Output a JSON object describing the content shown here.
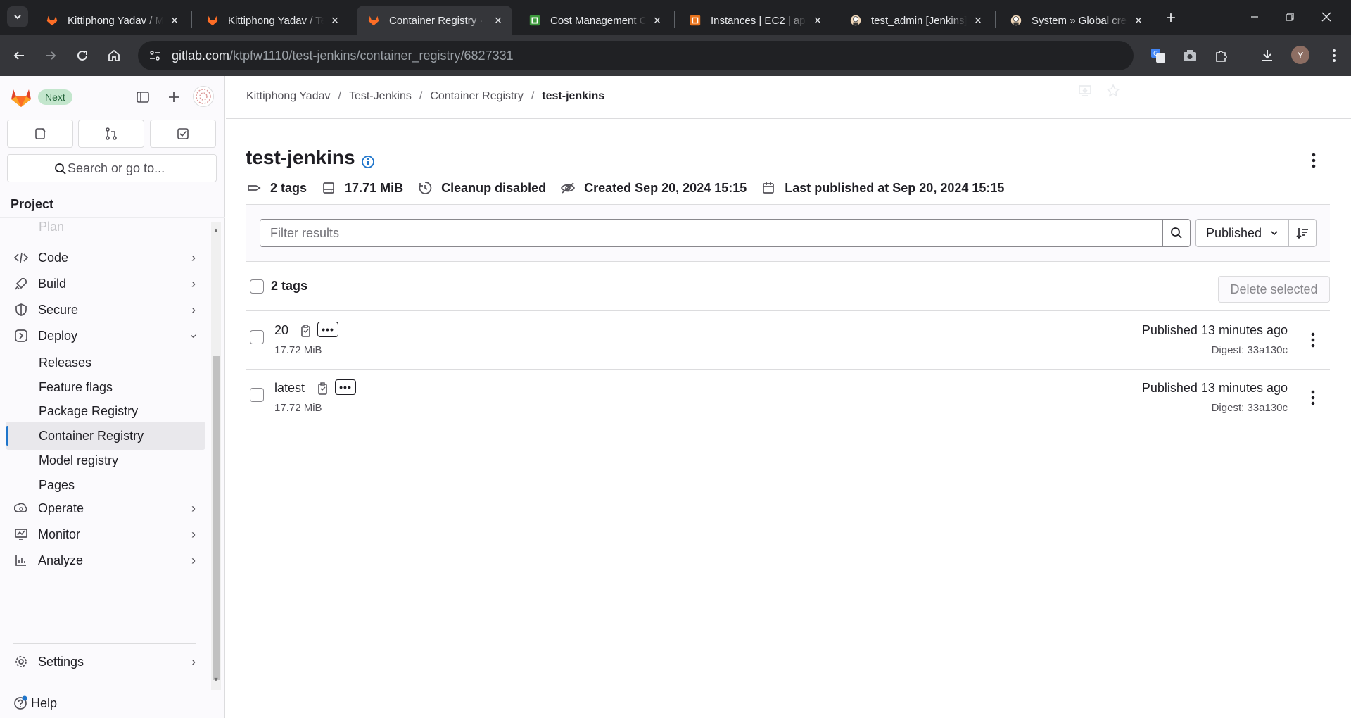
{
  "browser": {
    "tabs": [
      {
        "title": "Kittiphong Yadav / M",
        "favicon": "gitlab-icon",
        "active": false
      },
      {
        "title": "Kittiphong Yadav / Te",
        "favicon": "gitlab-icon",
        "active": false
      },
      {
        "title": "Container Registry · K",
        "favicon": "gitlab-icon",
        "active": true
      },
      {
        "title": "Cost Management Co",
        "favicon": "cost-management-icon",
        "active": false
      },
      {
        "title": "Instances | EC2 | ap-s",
        "favicon": "aws-icon",
        "active": false
      },
      {
        "title": "test_admin [Jenkins]",
        "favicon": "jenkins-icon",
        "active": false
      },
      {
        "title": "System » Global cred",
        "favicon": "jenkins-icon",
        "active": false
      }
    ],
    "url_host": "gitlab.com",
    "url_path": "/ktpfw1110/test-jenkins/container_registry/6827331",
    "profile_initial": "Y"
  },
  "sidebar": {
    "next_badge": "Next",
    "search_placeholder": "Search or go to...",
    "section_title": "Project",
    "plan_ghost": "Plan",
    "items": [
      {
        "label": "Code",
        "icon": "code-icon"
      },
      {
        "label": "Build",
        "icon": "rocket-icon"
      },
      {
        "label": "Secure",
        "icon": "shield-icon"
      },
      {
        "label": "Deploy",
        "icon": "deploy-icon"
      }
    ],
    "deploy_sub": [
      {
        "label": "Releases"
      },
      {
        "label": "Feature flags"
      },
      {
        "label": "Package Registry"
      },
      {
        "label": "Container Registry",
        "active": true
      },
      {
        "label": "Model registry"
      },
      {
        "label": "Pages"
      }
    ],
    "items_after": [
      {
        "label": "Operate",
        "icon": "operate-icon"
      },
      {
        "label": "Monitor",
        "icon": "monitor-icon"
      },
      {
        "label": "Analyze",
        "icon": "chart-icon"
      }
    ],
    "settings_label": "Settings",
    "help_label": "Help"
  },
  "breadcrumb": [
    "Kittiphong Yadav",
    "Test-Jenkins",
    "Container Registry",
    "test-jenkins"
  ],
  "page": {
    "title": "test-jenkins",
    "meta": {
      "tags": "2 tags",
      "size": "17.71 MiB",
      "cleanup": "Cleanup disabled",
      "created": "Created Sep 20, 2024 15:15",
      "last_published": "Last published at Sep 20, 2024 15:15"
    },
    "filter_placeholder": "Filter results",
    "sort_value": "Published",
    "list_count": "2 tags",
    "delete_label": "Delete selected",
    "tags": [
      {
        "name": "20",
        "size": "17.72 MiB",
        "published": "Published 13 minutes ago",
        "digest": "Digest: 33a130c"
      },
      {
        "name": "latest",
        "size": "17.72 MiB",
        "published": "Published 13 minutes ago",
        "digest": "Digest: 33a130c"
      }
    ]
  }
}
